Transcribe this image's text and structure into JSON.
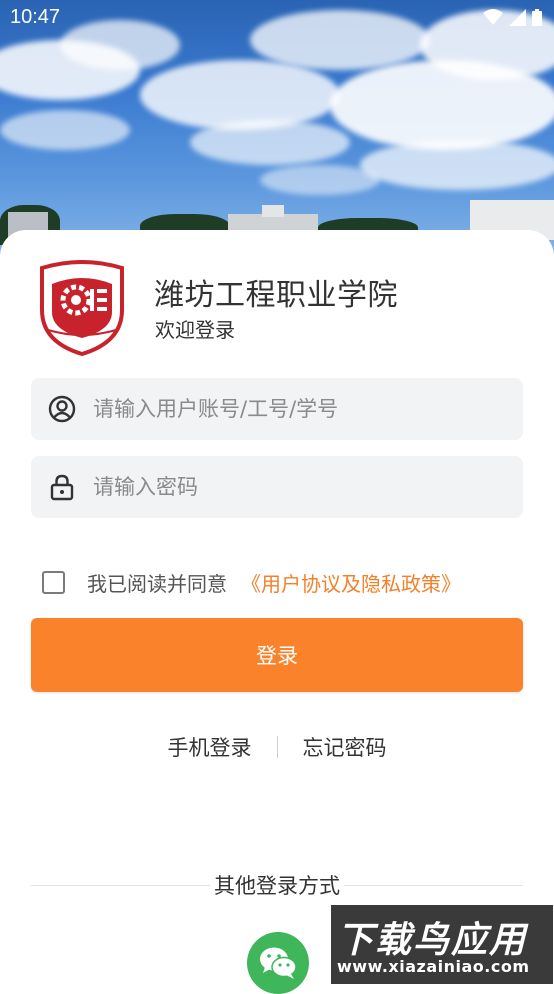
{
  "status_bar": {
    "time": "10:47"
  },
  "school": {
    "name": "潍坊工程职业学院",
    "welcome": "欢迎登录"
  },
  "form": {
    "account_placeholder": "请输入用户账号/工号/学号",
    "password_placeholder": "请输入密码",
    "agree_text": "我已阅读并同意",
    "agree_link": "《用户协议及隐私政策》",
    "agree_checked": false,
    "login_button": "登录"
  },
  "links": {
    "phone_login": "手机登录",
    "forgot_password": "忘记密码"
  },
  "other_login": {
    "label": "其他登录方式",
    "options": [
      "wechat-icon"
    ]
  },
  "watermark": {
    "title": "下载鸟应用",
    "url": "www.xiazainiao.com"
  },
  "colors": {
    "accent": "#f9822a",
    "link": "#f3812a",
    "wechat": "#3fb65a",
    "field_bg": "#f2f3f5"
  },
  "icons": [
    "wifi-icon",
    "signal-icon",
    "battery-icon",
    "user-circle-icon",
    "lock-icon",
    "checkbox-icon",
    "wechat-icon",
    "school-logo"
  ]
}
